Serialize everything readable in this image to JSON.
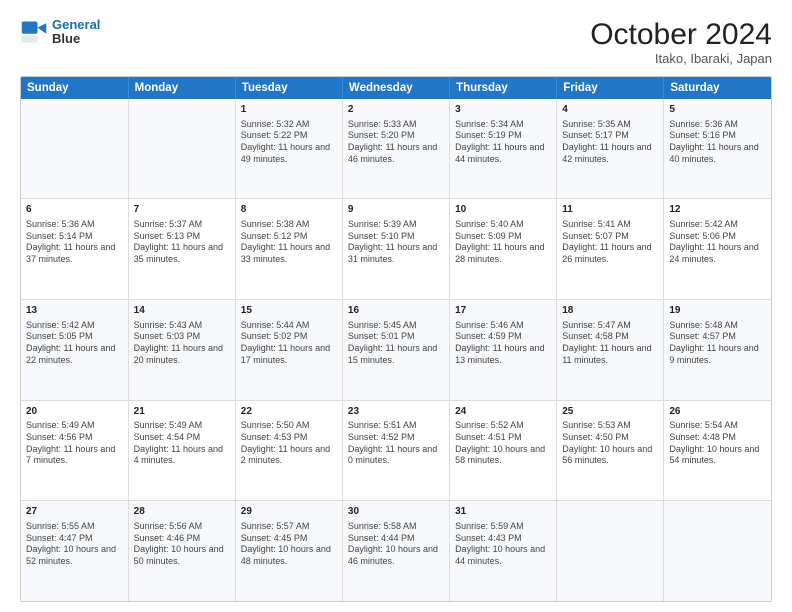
{
  "header": {
    "logo_line1": "General",
    "logo_line2": "Blue",
    "title": "October 2024",
    "subtitle": "Itako, Ibaraki, Japan"
  },
  "days_of_week": [
    "Sunday",
    "Monday",
    "Tuesday",
    "Wednesday",
    "Thursday",
    "Friday",
    "Saturday"
  ],
  "weeks": [
    [
      {
        "day": "",
        "info": ""
      },
      {
        "day": "",
        "info": ""
      },
      {
        "day": "1",
        "info": "Sunrise: 5:32 AM\nSunset: 5:22 PM\nDaylight: 11 hours and 49 minutes."
      },
      {
        "day": "2",
        "info": "Sunrise: 5:33 AM\nSunset: 5:20 PM\nDaylight: 11 hours and 46 minutes."
      },
      {
        "day": "3",
        "info": "Sunrise: 5:34 AM\nSunset: 5:19 PM\nDaylight: 11 hours and 44 minutes."
      },
      {
        "day": "4",
        "info": "Sunrise: 5:35 AM\nSunset: 5:17 PM\nDaylight: 11 hours and 42 minutes."
      },
      {
        "day": "5",
        "info": "Sunrise: 5:36 AM\nSunset: 5:16 PM\nDaylight: 11 hours and 40 minutes."
      }
    ],
    [
      {
        "day": "6",
        "info": "Sunrise: 5:36 AM\nSunset: 5:14 PM\nDaylight: 11 hours and 37 minutes."
      },
      {
        "day": "7",
        "info": "Sunrise: 5:37 AM\nSunset: 5:13 PM\nDaylight: 11 hours and 35 minutes."
      },
      {
        "day": "8",
        "info": "Sunrise: 5:38 AM\nSunset: 5:12 PM\nDaylight: 11 hours and 33 minutes."
      },
      {
        "day": "9",
        "info": "Sunrise: 5:39 AM\nSunset: 5:10 PM\nDaylight: 11 hours and 31 minutes."
      },
      {
        "day": "10",
        "info": "Sunrise: 5:40 AM\nSunset: 5:09 PM\nDaylight: 11 hours and 28 minutes."
      },
      {
        "day": "11",
        "info": "Sunrise: 5:41 AM\nSunset: 5:07 PM\nDaylight: 11 hours and 26 minutes."
      },
      {
        "day": "12",
        "info": "Sunrise: 5:42 AM\nSunset: 5:06 PM\nDaylight: 11 hours and 24 minutes."
      }
    ],
    [
      {
        "day": "13",
        "info": "Sunrise: 5:42 AM\nSunset: 5:05 PM\nDaylight: 11 hours and 22 minutes."
      },
      {
        "day": "14",
        "info": "Sunrise: 5:43 AM\nSunset: 5:03 PM\nDaylight: 11 hours and 20 minutes."
      },
      {
        "day": "15",
        "info": "Sunrise: 5:44 AM\nSunset: 5:02 PM\nDaylight: 11 hours and 17 minutes."
      },
      {
        "day": "16",
        "info": "Sunrise: 5:45 AM\nSunset: 5:01 PM\nDaylight: 11 hours and 15 minutes."
      },
      {
        "day": "17",
        "info": "Sunrise: 5:46 AM\nSunset: 4:59 PM\nDaylight: 11 hours and 13 minutes."
      },
      {
        "day": "18",
        "info": "Sunrise: 5:47 AM\nSunset: 4:58 PM\nDaylight: 11 hours and 11 minutes."
      },
      {
        "day": "19",
        "info": "Sunrise: 5:48 AM\nSunset: 4:57 PM\nDaylight: 11 hours and 9 minutes."
      }
    ],
    [
      {
        "day": "20",
        "info": "Sunrise: 5:49 AM\nSunset: 4:56 PM\nDaylight: 11 hours and 7 minutes."
      },
      {
        "day": "21",
        "info": "Sunrise: 5:49 AM\nSunset: 4:54 PM\nDaylight: 11 hours and 4 minutes."
      },
      {
        "day": "22",
        "info": "Sunrise: 5:50 AM\nSunset: 4:53 PM\nDaylight: 11 hours and 2 minutes."
      },
      {
        "day": "23",
        "info": "Sunrise: 5:51 AM\nSunset: 4:52 PM\nDaylight: 11 hours and 0 minutes."
      },
      {
        "day": "24",
        "info": "Sunrise: 5:52 AM\nSunset: 4:51 PM\nDaylight: 10 hours and 58 minutes."
      },
      {
        "day": "25",
        "info": "Sunrise: 5:53 AM\nSunset: 4:50 PM\nDaylight: 10 hours and 56 minutes."
      },
      {
        "day": "26",
        "info": "Sunrise: 5:54 AM\nSunset: 4:48 PM\nDaylight: 10 hours and 54 minutes."
      }
    ],
    [
      {
        "day": "27",
        "info": "Sunrise: 5:55 AM\nSunset: 4:47 PM\nDaylight: 10 hours and 52 minutes."
      },
      {
        "day": "28",
        "info": "Sunrise: 5:56 AM\nSunset: 4:46 PM\nDaylight: 10 hours and 50 minutes."
      },
      {
        "day": "29",
        "info": "Sunrise: 5:57 AM\nSunset: 4:45 PM\nDaylight: 10 hours and 48 minutes."
      },
      {
        "day": "30",
        "info": "Sunrise: 5:58 AM\nSunset: 4:44 PM\nDaylight: 10 hours and 46 minutes."
      },
      {
        "day": "31",
        "info": "Sunrise: 5:59 AM\nSunset: 4:43 PM\nDaylight: 10 hours and 44 minutes."
      },
      {
        "day": "",
        "info": ""
      },
      {
        "day": "",
        "info": ""
      }
    ]
  ]
}
